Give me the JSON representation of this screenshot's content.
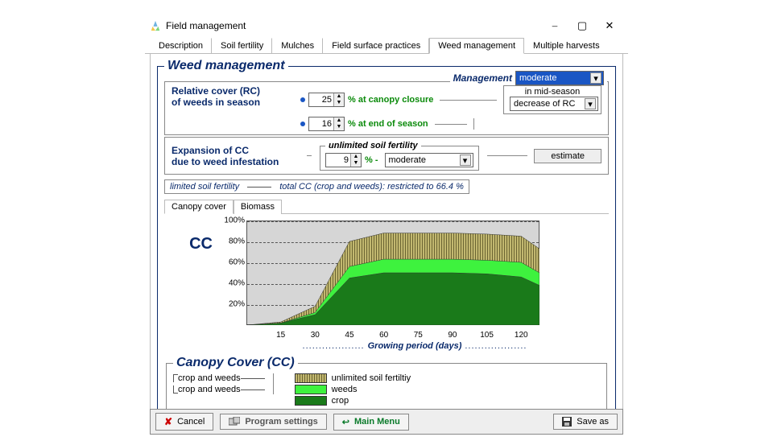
{
  "window": {
    "title": "Field management"
  },
  "tabs": {
    "items": [
      "Description",
      "Soil fertility",
      "Mulches",
      "Field surface practices",
      "Weed management",
      "Multiple harvests"
    ],
    "active": 4
  },
  "main": {
    "title": "Weed management",
    "mgmt_label": "Management",
    "mgmt_value": "moderate"
  },
  "rc": {
    "label1": "Relative cover (RC)",
    "label2": "of weeds in season",
    "closure_value": "25",
    "closure_text": "% at canopy closure",
    "eos_value": "16",
    "eos_text": "% at end of season",
    "mid_label": "in mid-season",
    "mid_value": "decrease of RC"
  },
  "exp": {
    "label1": "Expansion of CC",
    "label2": "due to weed infestation",
    "fert_label": "unlimited soil fertility",
    "value": "9",
    "pct_dash": "% -",
    "combo": "moderate",
    "est_btn": "estimate"
  },
  "restrict": {
    "label": "limited soil fertility",
    "text": "total CC (crop and weeds): restricted to 66.4 %"
  },
  "subtabs": {
    "items": [
      "Canopy cover",
      "Biomass"
    ],
    "active": 0
  },
  "chart_data": {
    "type": "area",
    "cc_label": "CC",
    "ylabel_pct": true,
    "ylim": [
      0,
      100
    ],
    "yticks": [
      20,
      40,
      60,
      80,
      100
    ],
    "x": [
      0,
      15,
      30,
      45,
      60,
      75,
      90,
      105,
      120,
      128
    ],
    "xticks": [
      15,
      30,
      45,
      60,
      75,
      90,
      105,
      120
    ],
    "xlabel": "Growing period (days)",
    "series": [
      {
        "name": "crop and weeds (unlimited)",
        "style": "hatch",
        "values": [
          0,
          3,
          18,
          80,
          88,
          88,
          88,
          87,
          85,
          73
        ]
      },
      {
        "name": "crop and weeds (limited)",
        "style": "lgreen",
        "values": [
          0,
          2,
          12,
          56,
          63,
          63,
          63,
          62,
          60,
          50
        ]
      },
      {
        "name": "crop",
        "style": "dgreen",
        "values": [
          0,
          2,
          10,
          45,
          50,
          50,
          50,
          49,
          46,
          38
        ]
      }
    ]
  },
  "legend": {
    "title": "Canopy Cover (CC)",
    "left1": "crop and weeds",
    "left2": "crop and weeds",
    "r1": "unlimited soil fertiltiy",
    "r2": "weeds",
    "r3": "crop"
  },
  "footer": {
    "cancel": "Cancel",
    "program": "Program settings",
    "main": "Main Menu",
    "save": "Save as"
  }
}
